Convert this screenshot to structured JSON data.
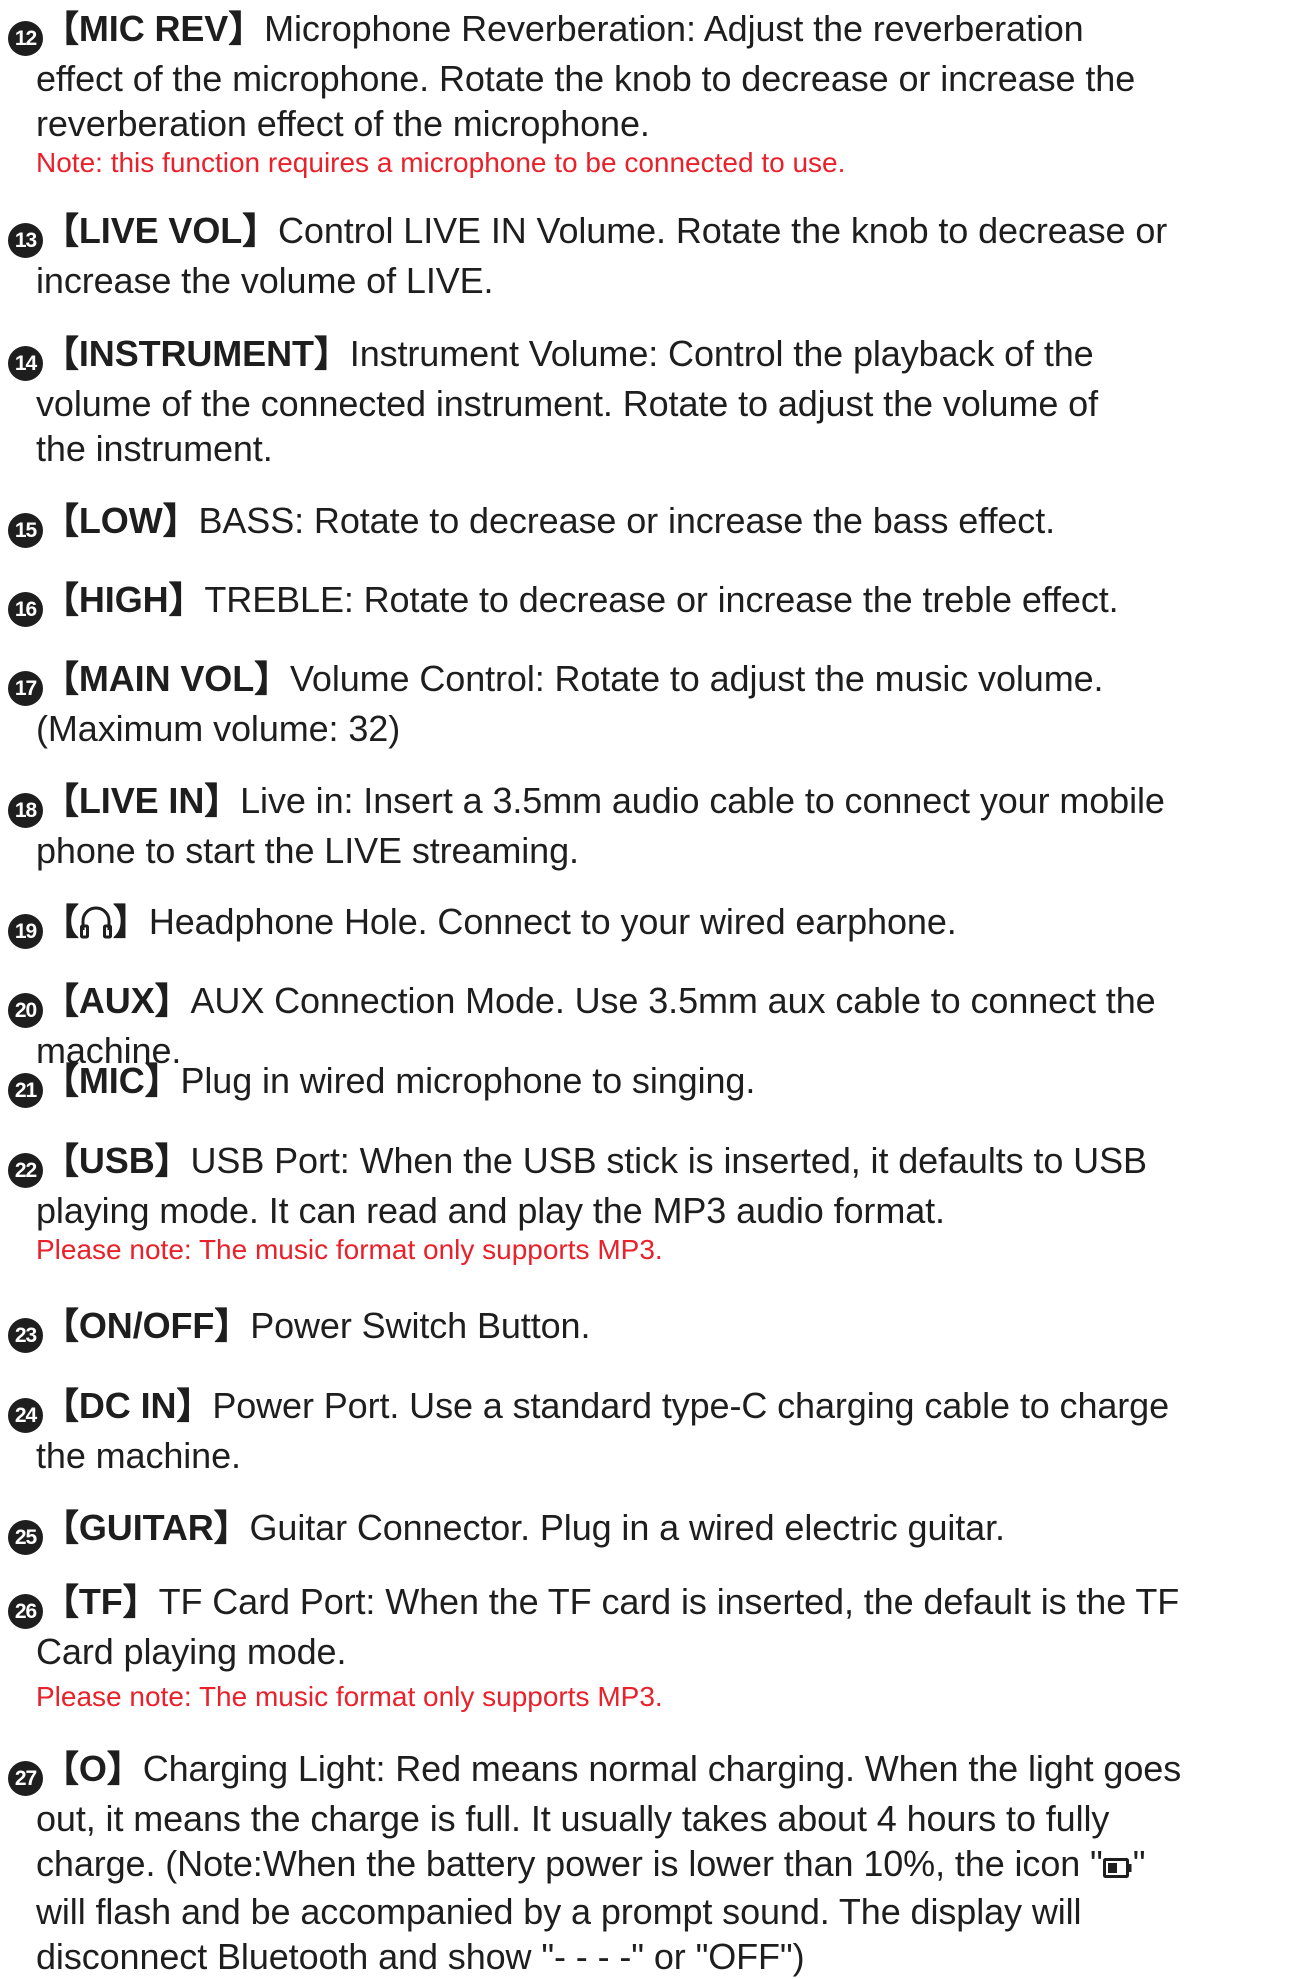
{
  "items": [
    {
      "number": "12",
      "tag": "【MIC REV】",
      "lines": [
        "Microphone Reverberation: Adjust the reverberation",
        "effect of the microphone. Rotate the knob to decrease or increase the",
        "reverberation effect of the microphone."
      ],
      "note": "Note: this function requires a microphone to be connected to use."
    },
    {
      "number": "13",
      "tag": "【LIVE VOL】",
      "lines": [
        "Control LIVE IN Volume. Rotate the knob to decrease or",
        "increase the volume of LIVE."
      ]
    },
    {
      "number": "14",
      "tag": "【INSTRUMENT】",
      "lines": [
        "Instrument Volume: Control the playback of the",
        "volume of the connected instrument. Rotate to adjust the volume of",
        "the instrument."
      ]
    },
    {
      "number": "15",
      "tag": "【LOW】",
      "lines": [
        "BASS: Rotate to decrease or increase the bass effect."
      ]
    },
    {
      "number": "16",
      "tag": "【HIGH】",
      "lines": [
        "TREBLE: Rotate to decrease or increase the treble effect."
      ]
    },
    {
      "number": "17",
      "tag": "【MAIN VOL】",
      "lines": [
        "Volume Control: Rotate to adjust the music volume.",
        "(Maximum volume: 32)"
      ]
    },
    {
      "number": "18",
      "tag": "【LIVE IN】",
      "lines": [
        "Live in: Insert a 3.5mm audio cable to connect your mobile",
        "phone to start the  LIVE streaming."
      ]
    },
    {
      "number": "19",
      "tag_open": "【",
      "tag_close": "】",
      "icon": "headphone-icon",
      "lines": [
        "Headphone Hole. Connect to your wired earphone."
      ]
    },
    {
      "number": "20",
      "tag": "【AUX】",
      "lines": [
        "AUX Connection Mode. Use 3.5mm aux cable to connect the",
        "machine."
      ]
    },
    {
      "number": "21",
      "tag": "【MIC】",
      "lines": [
        "Plug in wired microphone to singing."
      ]
    },
    {
      "number": "22",
      "tag": "【USB】",
      "lines": [
        "USB Port: When the USB stick is inserted, it defaults to USB",
        "playing mode. It can read and play the MP3 audio format."
      ],
      "note": "Please note: The music format only supports MP3."
    },
    {
      "number": "23",
      "tag": "【ON/OFF】",
      "lines": [
        "Power Switch Button."
      ]
    },
    {
      "number": "24",
      "tag": "【DC IN】",
      "lines": [
        "Power Port. Use a standard type-C charging cable to charge",
        "the machine."
      ]
    },
    {
      "number": "25",
      "tag": "【GUITAR】",
      "lines": [
        "Guitar Connector. Plug in a wired electric guitar."
      ]
    },
    {
      "number": "26",
      "tag": "【TF】",
      "lines": [
        "TF Card Port: When the TF card is inserted, the default is the TF",
        "Card playing mode."
      ],
      "note": "Please note: The music format only supports MP3."
    },
    {
      "number": "27",
      "tag": "【O】",
      "lines": [
        "Charging Light: Red means normal charging. When the light goes",
        "out, it means the charge is full. It usually takes about 4 hours to fully"
      ],
      "line3_before": "charge. (Note:When the battery power is lower than 10%, the icon \"",
      "line3_icon": "low-battery-icon",
      "line3_after": "\"",
      "lines_end": [
        "will flash and be accompanied by a prompt sound. The display will",
        "disconnect Bluetooth and show \"- - - -\" or \"OFF\")"
      ]
    }
  ]
}
